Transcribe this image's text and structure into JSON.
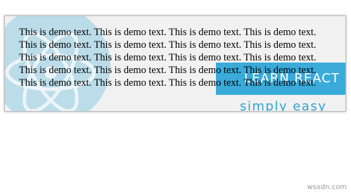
{
  "demo": {
    "text": "This is demo text. This is demo text. This is demo text. This is demo text. This is demo text. This is demo text. This is demo text. This is demo text. This is demo text. This is demo text. This is demo text. This is demo text. This is demo text. This is demo text. This is demo text. This is demo text. This is demo text. This is demo text. This is demo text. This is demo text."
  },
  "background": {
    "brand_title": "LEARN REACT",
    "brand_tagline": "simply easy",
    "logo_icon": "react-atom-icon",
    "banner_color": "#3aaad9",
    "logo_color": "#a8d4e6"
  },
  "watermark": "wsxdn.com"
}
